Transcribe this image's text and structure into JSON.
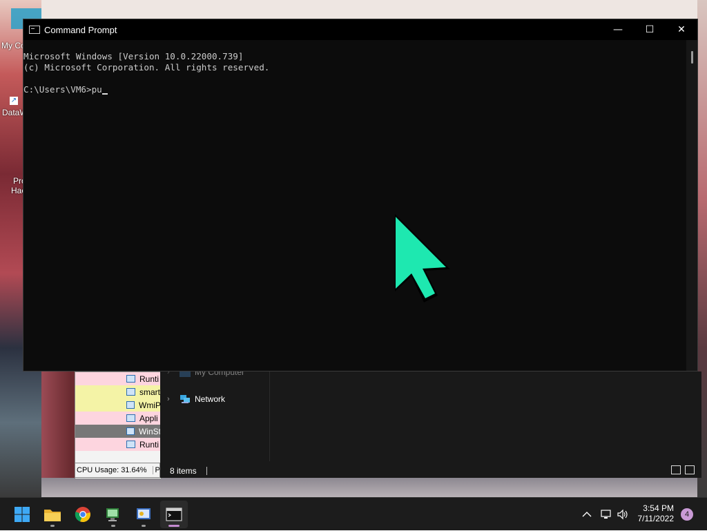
{
  "desktop": {
    "icons": [
      {
        "label": "My Co"
      },
      {
        "label": "DataW"
      },
      {
        "label": "Pro"
      },
      {
        "label": "Hac"
      }
    ]
  },
  "cmd": {
    "title": "Command Prompt",
    "minimize_glyph": "—",
    "maximize_glyph": "☐",
    "close_glyph": "✕",
    "lines": [
      "Microsoft Windows [Version 10.0.22000.739]",
      "(c) Microsoft Corporation. All rights reserved.",
      "",
      "C:\\Users\\VM6>pu"
    ]
  },
  "taskmgr": {
    "rows": [
      {
        "label": "Runti",
        "color": "#fdd5df"
      },
      {
        "label": "smart",
        "color": "#f4f3a6"
      },
      {
        "label": "WmiP",
        "color": "#f4f3a6"
      },
      {
        "label": "Appli",
        "color": "#fdd5df"
      },
      {
        "label": "WinSt",
        "color": "#777777"
      },
      {
        "label": "Runti",
        "color": "#fdd5df"
      }
    ],
    "status": "CPU Usage: 31.64%",
    "status_tail": "P"
  },
  "explorer": {
    "nav": [
      {
        "label": "My Computer",
        "icon": "computer-icon"
      },
      {
        "label": "Network",
        "icon": "network-icon"
      }
    ],
    "status": "8 items"
  },
  "taskbar": {
    "apps": [
      {
        "name": "start-button",
        "icon": "windows-logo-icon"
      },
      {
        "name": "file-explorer",
        "icon": "folder-icon"
      },
      {
        "name": "chrome",
        "icon": "chrome-icon"
      },
      {
        "name": "app-1",
        "icon": "app-icon"
      },
      {
        "name": "app-2",
        "icon": "app-icon"
      },
      {
        "name": "command-prompt",
        "icon": "terminal-icon"
      }
    ],
    "time": "3:54 PM",
    "date": "7/11/2022",
    "notification_count": "4"
  },
  "colors": {
    "cursor_fill": "#1ee8b0",
    "cmd_text": "#cccccc",
    "taskbar_bg": "#1c1c1c"
  }
}
